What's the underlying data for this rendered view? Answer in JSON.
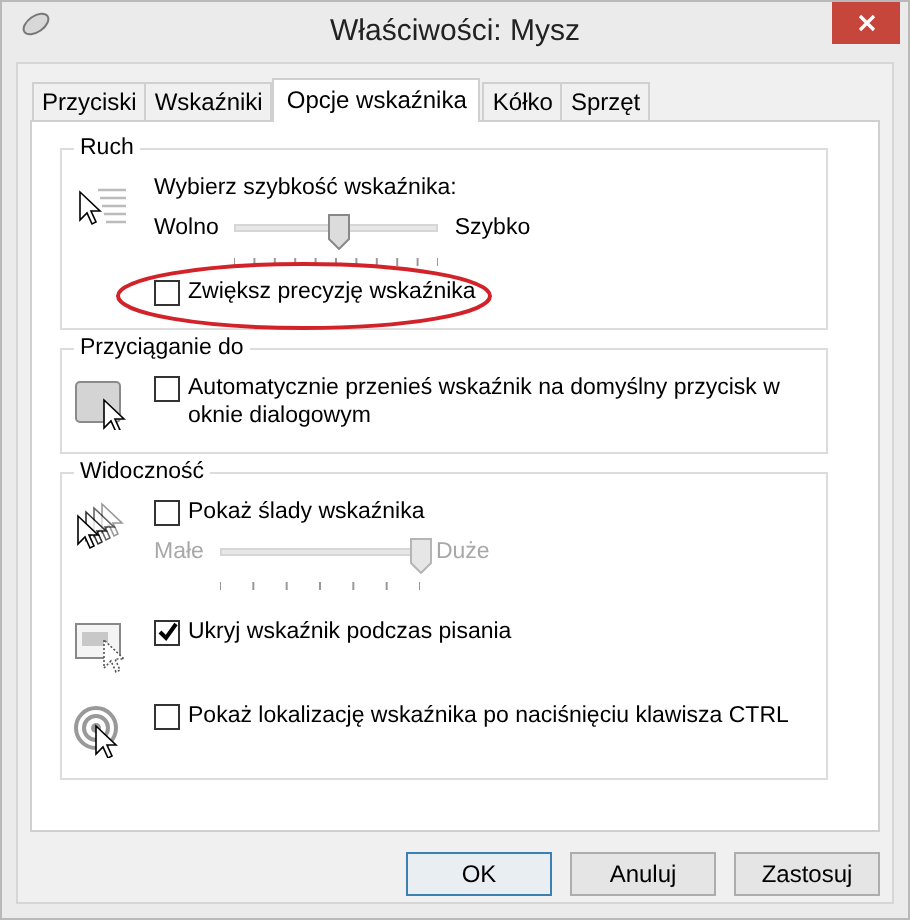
{
  "window": {
    "title": "Właściwości: Mysz"
  },
  "tabs": [
    {
      "label": "Przyciski",
      "selected": false
    },
    {
      "label": "Wskaźniki",
      "selected": false
    },
    {
      "label": "Opcje wskaźnika",
      "selected": true
    },
    {
      "label": "Kółko",
      "selected": false
    },
    {
      "label": "Sprzęt",
      "selected": false
    }
  ],
  "groups": [
    {
      "title": "Ruch",
      "sections": [
        {
          "items": [
            {
              "kind": "slider",
              "label": "Wybierz szybkość wskaźnika:",
              "min_label": "Wolno",
              "max_label": "Szybko",
              "level": 0.51,
              "disabled": false
            },
            {
              "kind": "checkbox",
              "label": "Zwiększ precyzję wskaźnika",
              "checked": false,
              "highlighted": true
            }
          ]
        }
      ]
    },
    {
      "title": "Przyciąganie do",
      "sections": [
        {
          "items": [
            {
              "kind": "checkbox",
              "label": "Automatycznie przenieś wskaźnik na domyślny przycisk w oknie dialogowym",
              "checked": false,
              "highlighted": false
            }
          ]
        }
      ]
    },
    {
      "title": "Widoczność",
      "sections": [
        {
          "items": [
            {
              "kind": "checkbox",
              "label": "Pokaż ślady wskaźnika",
              "checked": false,
              "highlighted": false
            },
            {
              "kind": "slider",
              "min_label": "Małe",
              "max_label": "Duże",
              "level": 1,
              "disabled": true
            }
          ]
        },
        {
          "items": [
            {
              "kind": "checkbox",
              "label": "Ukryj wskaźnik podczas pisania",
              "checked": true,
              "highlighted": false
            }
          ]
        },
        {
          "items": [
            {
              "kind": "checkbox",
              "label": "Pokaż lokalizację wskaźnika po naciśnięciu klawisza CTRL",
              "checked": false,
              "highlighted": false
            }
          ]
        }
      ]
    }
  ],
  "buttons": [
    {
      "label": "OK",
      "default": true
    },
    {
      "label": "Anuluj",
      "default": false
    },
    {
      "label": "Zastosuj",
      "default": false
    }
  ]
}
